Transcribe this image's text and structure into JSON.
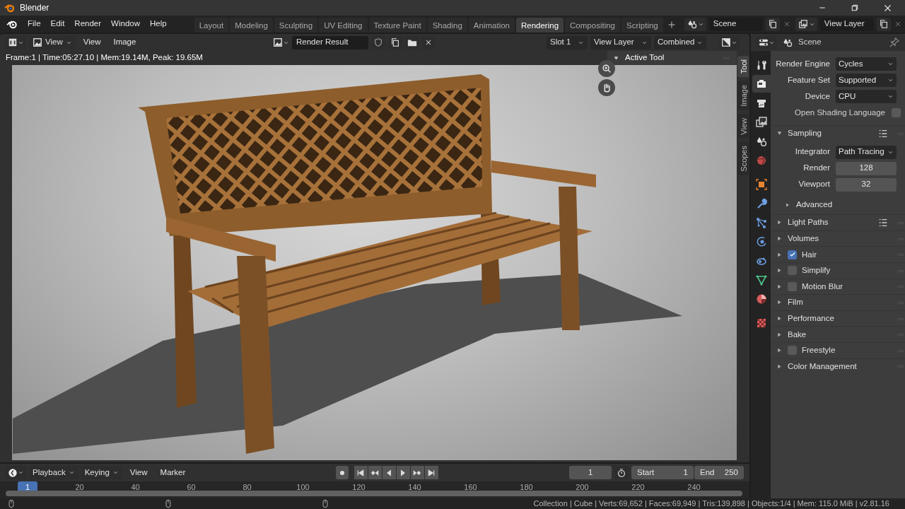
{
  "window": {
    "title": "Blender"
  },
  "menu": [
    "File",
    "Edit",
    "Render",
    "Window",
    "Help"
  ],
  "workspaces": [
    {
      "label": "Layout",
      "selected": false
    },
    {
      "label": "Modeling",
      "selected": false
    },
    {
      "label": "Sculpting",
      "selected": false
    },
    {
      "label": "UV Editing",
      "selected": false
    },
    {
      "label": "Texture Paint",
      "selected": false
    },
    {
      "label": "Shading",
      "selected": false
    },
    {
      "label": "Animation",
      "selected": false
    },
    {
      "label": "Rendering",
      "selected": true
    },
    {
      "label": "Compositing",
      "selected": false
    },
    {
      "label": "Scripting",
      "selected": false
    }
  ],
  "scene": "Scene",
  "view_layer": "View Layer",
  "image_editor": {
    "view_mode": "View",
    "menus": [
      "View",
      "Image"
    ],
    "image": "Render Result",
    "slot": "Slot 1",
    "layer": "View Layer",
    "pass": "Combined",
    "info": "Frame:1 | Time:05:27.10 | Mem:19.14M, Peak: 19.65M",
    "sidebar_panel": "Active Tool",
    "sidebar_tabs": [
      {
        "label": "Tool",
        "selected": true
      },
      {
        "label": "Image",
        "selected": false
      },
      {
        "label": "View",
        "selected": false
      },
      {
        "label": "Scopes",
        "selected": false
      }
    ]
  },
  "properties": {
    "context": "Scene",
    "tabs": [
      {
        "kind": "tool",
        "selected": false
      },
      {
        "kind": "render",
        "selected": true
      },
      {
        "kind": "output",
        "selected": false
      },
      {
        "kind": "viewlayer",
        "selected": false
      },
      {
        "kind": "scene",
        "selected": false
      },
      {
        "kind": "world",
        "selected": false
      },
      {
        "kind": "object",
        "selected": false
      },
      {
        "kind": "modifiers",
        "selected": false
      },
      {
        "kind": "particles",
        "selected": false
      },
      {
        "kind": "physics",
        "selected": false
      },
      {
        "kind": "constraints",
        "selected": false
      },
      {
        "kind": "data",
        "selected": false
      },
      {
        "kind": "material",
        "selected": false
      },
      {
        "kind": "texture",
        "selected": false
      }
    ],
    "fields": [
      {
        "kind": "dropdown",
        "label": "Render Engine",
        "value": "Cycles"
      },
      {
        "kind": "dropdown",
        "label": "Feature Set",
        "value": "Supported"
      },
      {
        "kind": "dropdown",
        "label": "Device",
        "value": "CPU"
      },
      {
        "kind": "checkbox",
        "label": "Open Shading Language",
        "checked": false
      }
    ],
    "sections": [
      {
        "kind": "plain",
        "label": "Sampling",
        "expanded": true,
        "presets": true,
        "fields": [
          {
            "kind": "dropdown",
            "label": "Integrator",
            "value": "Path Tracing"
          },
          {
            "kind": "number",
            "label": "Render",
            "value": "128"
          },
          {
            "kind": "number",
            "label": "Viewport",
            "value": "32"
          }
        ],
        "subpanels": [
          {
            "label": "Advanced",
            "expanded": false
          }
        ]
      },
      {
        "kind": "plain",
        "label": "Light Paths",
        "expanded": false,
        "presets": true
      },
      {
        "kind": "plain",
        "label": "Volumes",
        "expanded": false,
        "presets": false
      },
      {
        "kind": "toggle",
        "label": "Hair",
        "expanded": false,
        "presets": false,
        "checked": true
      },
      {
        "kind": "toggle",
        "label": "Simplify",
        "expanded": false,
        "presets": false,
        "checked": false
      },
      {
        "kind": "toggle",
        "label": "Motion Blur",
        "expanded": false,
        "presets": false,
        "checked": false
      },
      {
        "kind": "plain",
        "label": "Film",
        "expanded": false,
        "presets": false
      },
      {
        "kind": "plain",
        "label": "Performance",
        "expanded": false,
        "presets": false
      },
      {
        "kind": "plain",
        "label": "Bake",
        "expanded": false,
        "presets": false
      },
      {
        "kind": "toggle",
        "label": "Freestyle",
        "expanded": false,
        "presets": false,
        "checked": false
      },
      {
        "kind": "plain",
        "label": "Color Management",
        "expanded": false,
        "presets": false
      }
    ]
  },
  "timeline": {
    "menus": [
      "Playback",
      "Keying",
      "View",
      "Marker"
    ],
    "current_frame": "1",
    "start": {
      "label": "Start",
      "value": "1"
    },
    "end": {
      "label": "End",
      "value": "250"
    },
    "playhead": "1",
    "ticks": [
      "20",
      "40",
      "60",
      "80",
      "100",
      "120",
      "140",
      "160",
      "180",
      "200",
      "220",
      "240"
    ]
  },
  "status_bar": "Collection | Cube | Verts:69,652 | Faces:69,949 | Tris:139,898 | Objects:1/4 | Mem: 115.0 MiB | v2.81.16"
}
